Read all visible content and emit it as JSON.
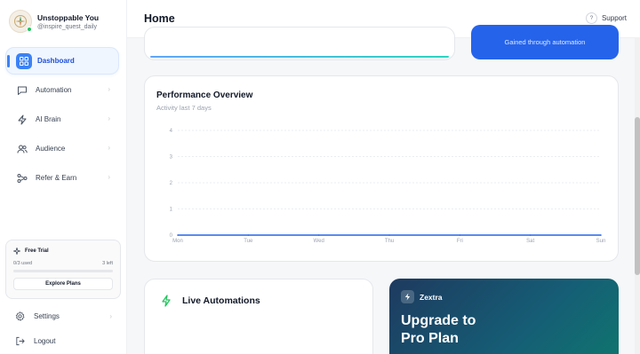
{
  "app": {
    "account_name": "Unstoppable You",
    "account_handle": "@inspire_quest_daily"
  },
  "sidebar": {
    "items": [
      {
        "label": "Dashboard",
        "icon": "grid-icon",
        "active": true
      },
      {
        "label": "Automation",
        "icon": "chat-icon",
        "active": false
      },
      {
        "label": "AI Brain",
        "icon": "bolt-icon",
        "active": false
      },
      {
        "label": "Audience",
        "icon": "users-icon",
        "active": false
      },
      {
        "label": "Refer & Earn",
        "icon": "share-icon",
        "active": false
      }
    ],
    "trial": {
      "title": "Free Trial",
      "used_text": "0/3 used",
      "left_text": "3 left",
      "progress": 0,
      "button_label": "Explore Plans"
    },
    "settings_label": "Settings",
    "logout_label": "Logout"
  },
  "header": {
    "title": "Home",
    "support_label": "Support",
    "support_icon_glyph": "?"
  },
  "top_cards": {
    "right_caption": "Gained through automation"
  },
  "performance": {
    "title": "Performance Overview",
    "subtitle": "Activity last 7 days"
  },
  "chart_data": {
    "type": "line",
    "categories": [
      "Mon",
      "Tue",
      "Wed",
      "Thu",
      "Fri",
      "Sat",
      "Sun"
    ],
    "series": [
      {
        "values": [
          0,
          0,
          0,
          0,
          0,
          0,
          0
        ]
      }
    ],
    "yticks": [
      0,
      1,
      2,
      3,
      4
    ],
    "ylim": [
      0,
      4
    ],
    "grid": true,
    "line_color": "#2563eb"
  },
  "live_automations": {
    "title": "Live Automations"
  },
  "upgrade": {
    "brand": "Zextra",
    "headline_line1": "Upgrade to",
    "headline_line2": "Pro Plan"
  },
  "colors": {
    "accent": "#3b82f6",
    "primary_blue": "#2563eb",
    "success": "#22c55e"
  }
}
